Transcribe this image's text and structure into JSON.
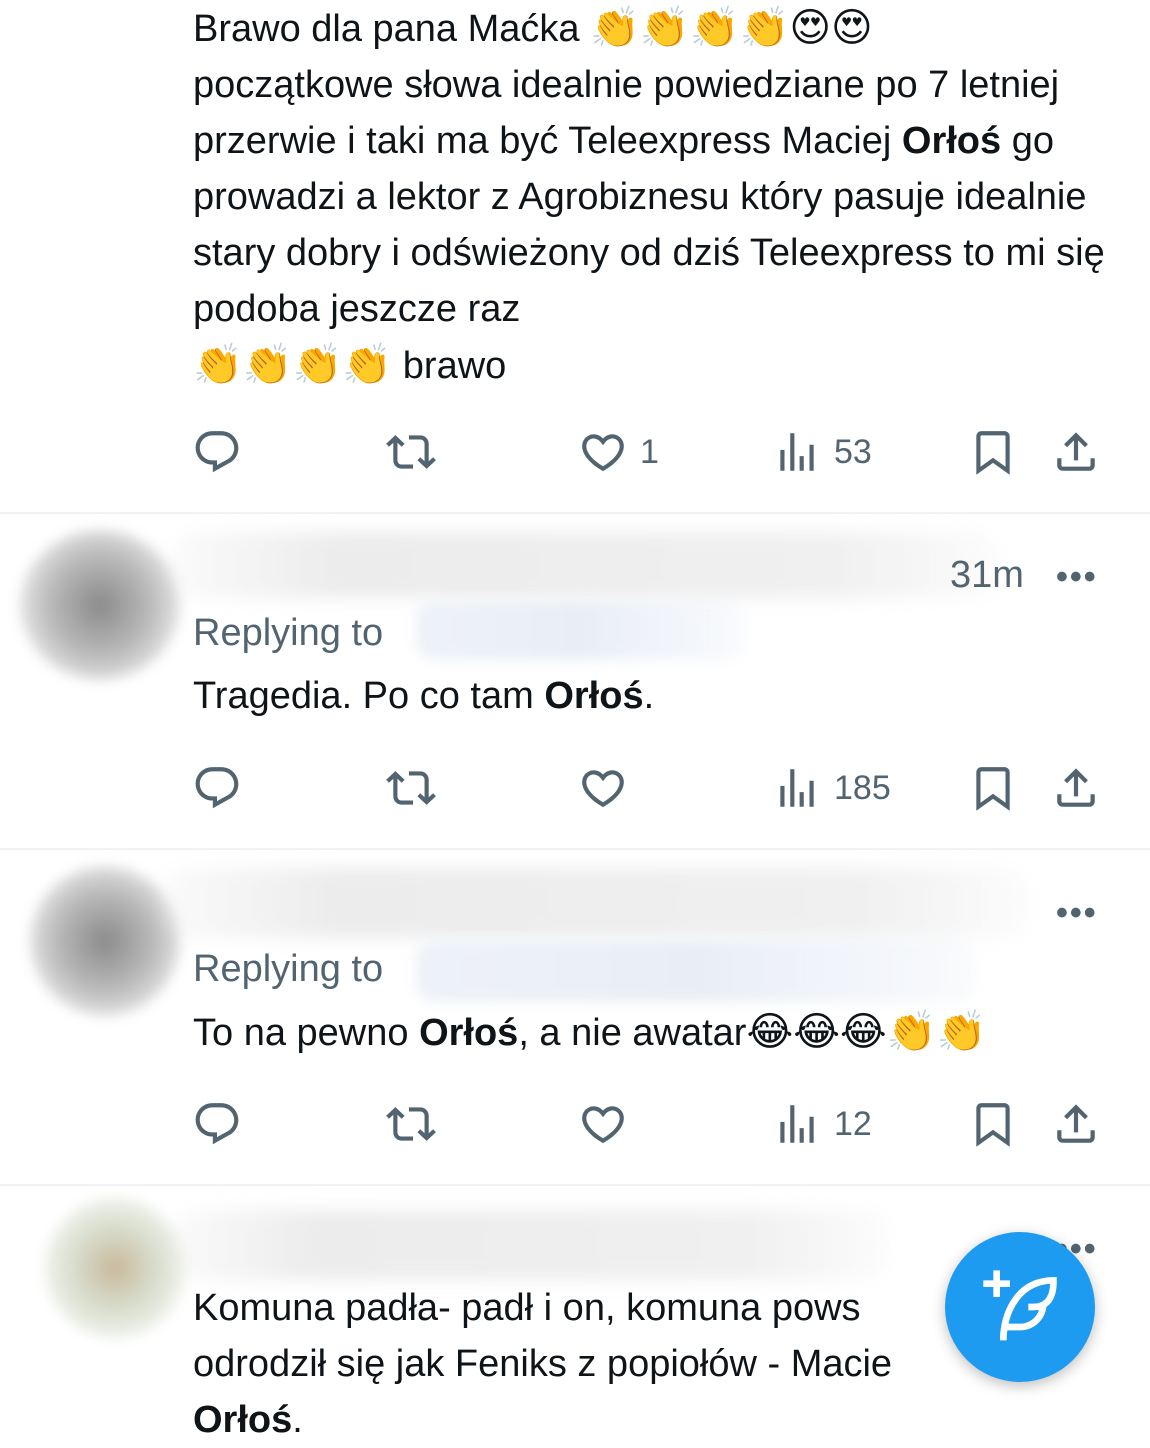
{
  "tweets": [
    {
      "text_parts": [
        "Brawo dla pana Maćka ",
        "👏👏👏👏😍😍",
        " początkowe słowa idealnie powiedziane po 7 letniej przerwie i taki ma być Teleexpress Maciej ",
        "Orłoś",
        " go prowadzi a lektor z Agrobiznesu który pasuje idealnie stary dobry i odświeżony od dziś Teleexpress to mi się podoba jeszcze raz ",
        "👏👏👏👏",
        " brawo"
      ],
      "actions": {
        "likes": "1",
        "views": "53"
      }
    },
    {
      "time": "31m",
      "replying_to": "Replying to",
      "text_parts": [
        "Tragedia. Po co tam ",
        "Orłoś",
        "."
      ],
      "actions": {
        "likes": "",
        "views": "185"
      }
    },
    {
      "replying_to": "Replying to",
      "text_parts": [
        "To na pewno ",
        "Orłoś",
        ", a nie awatar",
        "😂😂😂👏👏"
      ],
      "actions": {
        "likes": "",
        "views": "12"
      }
    },
    {
      "text_parts": [
        "Komuna padła- padł i on, komuna pows",
        "odrodził się jak Feniks z popiołów - Macie",
        "Orłoś",
        "."
      ]
    }
  ],
  "more_label": "•••",
  "icons": {
    "reply": "reply-icon",
    "retweet": "retweet-icon",
    "like": "heart-icon",
    "views": "views-icon",
    "bookmark": "bookmark-icon",
    "share": "share-icon",
    "compose": "compose-icon"
  },
  "colors": {
    "text": "#0f1419",
    "muted": "#536471",
    "divider": "#eff3f4",
    "accent": "#1d9bf0"
  }
}
